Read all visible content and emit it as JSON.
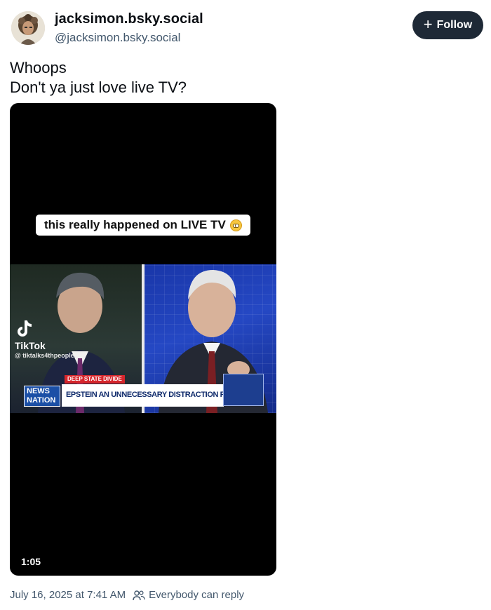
{
  "author": {
    "display_name": "jacksimon.bsky.social",
    "handle": "@jacksimon.bsky.social",
    "avatar_icon": "avatar-portrait"
  },
  "follow_button": {
    "label": "Follow",
    "icon": "plus-icon"
  },
  "post": {
    "lines": [
      "Whoops",
      "Don't ya just love live TV?"
    ]
  },
  "video": {
    "caption": "this really happened on LIVE TV",
    "caption_emoji": "flushed-face-emoji",
    "watermark_app": "TikTok",
    "watermark_handle": "@ tiktalks4thpeople",
    "lower_third_tag": "DEEP STATE DIVIDE",
    "network_logo": "NEWS NATION",
    "headline": "EPSTEIN AN UNNECESSARY DISTRACTION FOR TRUMP",
    "duration": "1:05"
  },
  "footer": {
    "timestamp": "July 16, 2025 at 7:41 AM",
    "reply_setting": "Everybody can reply",
    "reply_icon": "people-icon"
  },
  "colors": {
    "follow_bg": "#1e2936",
    "secondary_text": "#42576c",
    "news_red": "#d6262c",
    "news_blue": "#1b4fa6"
  }
}
